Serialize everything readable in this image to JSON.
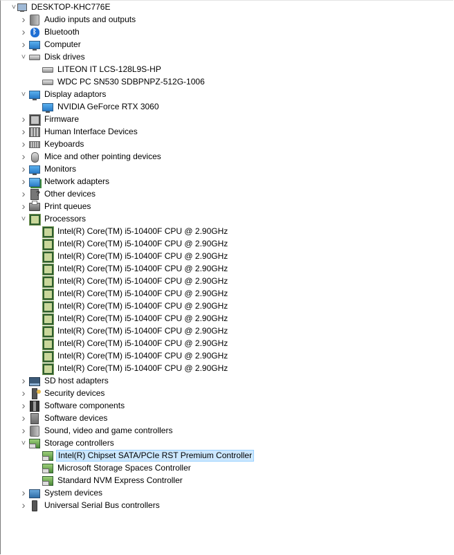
{
  "root": {
    "label": "DESKTOP-KHC776E",
    "icon": "computer-icon"
  },
  "categories": [
    {
      "label": "Audio inputs and outputs",
      "icon": "speaker-icon",
      "expanded": false
    },
    {
      "label": "Bluetooth",
      "icon": "bluetooth-icon",
      "expanded": false
    },
    {
      "label": "Computer",
      "icon": "monitor-icon",
      "expanded": false
    },
    {
      "label": "Disk drives",
      "icon": "disk-drive-icon",
      "expanded": true,
      "children": [
        "LITEON IT LCS-128L9S-HP",
        "WDC PC SN530 SDBPNPZ-512G-1006"
      ]
    },
    {
      "label": "Display adaptors",
      "icon": "display-adapter-icon",
      "expanded": true,
      "children": [
        "NVIDIA GeForce RTX 3060"
      ]
    },
    {
      "label": "Firmware",
      "icon": "firmware-icon",
      "expanded": false
    },
    {
      "label": "Human Interface Devices",
      "icon": "hid-icon",
      "expanded": false
    },
    {
      "label": "Keyboards",
      "icon": "keyboard-icon",
      "expanded": false
    },
    {
      "label": "Mice and other pointing devices",
      "icon": "mouse-icon",
      "expanded": false
    },
    {
      "label": "Monitors",
      "icon": "monitor-icon",
      "expanded": false
    },
    {
      "label": "Network adapters",
      "icon": "network-adapter-icon",
      "expanded": false
    },
    {
      "label": "Other devices",
      "icon": "unknown-device-icon",
      "expanded": false
    },
    {
      "label": "Print queues",
      "icon": "printer-icon",
      "expanded": false
    },
    {
      "label": "Processors",
      "icon": "processor-icon",
      "expanded": true,
      "children": [
        "Intel(R) Core(TM) i5-10400F CPU @ 2.90GHz",
        "Intel(R) Core(TM) i5-10400F CPU @ 2.90GHz",
        "Intel(R) Core(TM) i5-10400F CPU @ 2.90GHz",
        "Intel(R) Core(TM) i5-10400F CPU @ 2.90GHz",
        "Intel(R) Core(TM) i5-10400F CPU @ 2.90GHz",
        "Intel(R) Core(TM) i5-10400F CPU @ 2.90GHz",
        "Intel(R) Core(TM) i5-10400F CPU @ 2.90GHz",
        "Intel(R) Core(TM) i5-10400F CPU @ 2.90GHz",
        "Intel(R) Core(TM) i5-10400F CPU @ 2.90GHz",
        "Intel(R) Core(TM) i5-10400F CPU @ 2.90GHz",
        "Intel(R) Core(TM) i5-10400F CPU @ 2.90GHz",
        "Intel(R) Core(TM) i5-10400F CPU @ 2.90GHz"
      ]
    },
    {
      "label": "SD host adapters",
      "icon": "sd-host-icon",
      "expanded": false
    },
    {
      "label": "Security devices",
      "icon": "security-key-icon",
      "expanded": false
    },
    {
      "label": "Software components",
      "icon": "puzzle-icon",
      "expanded": false
    },
    {
      "label": "Software devices",
      "icon": "software-device-icon",
      "expanded": false
    },
    {
      "label": "Sound, video and game controllers",
      "icon": "speaker-icon",
      "expanded": false
    },
    {
      "label": "Storage controllers",
      "icon": "storage-controller-icon",
      "expanded": true,
      "children": [
        "Intel(R) Chipset SATA/PCIe RST Premium Controller",
        "Microsoft Storage Spaces Controller",
        "Standard NVM Express Controller"
      ],
      "selected_child": 0
    },
    {
      "label": "System devices",
      "icon": "system-device-icon",
      "expanded": false
    },
    {
      "label": "Universal Serial Bus controllers",
      "icon": "usb-icon",
      "expanded": false
    }
  ],
  "colors": {
    "selection_bg": "#cce8ff",
    "selection_border": "#99d1ff",
    "expander": "#6d6d6d"
  }
}
